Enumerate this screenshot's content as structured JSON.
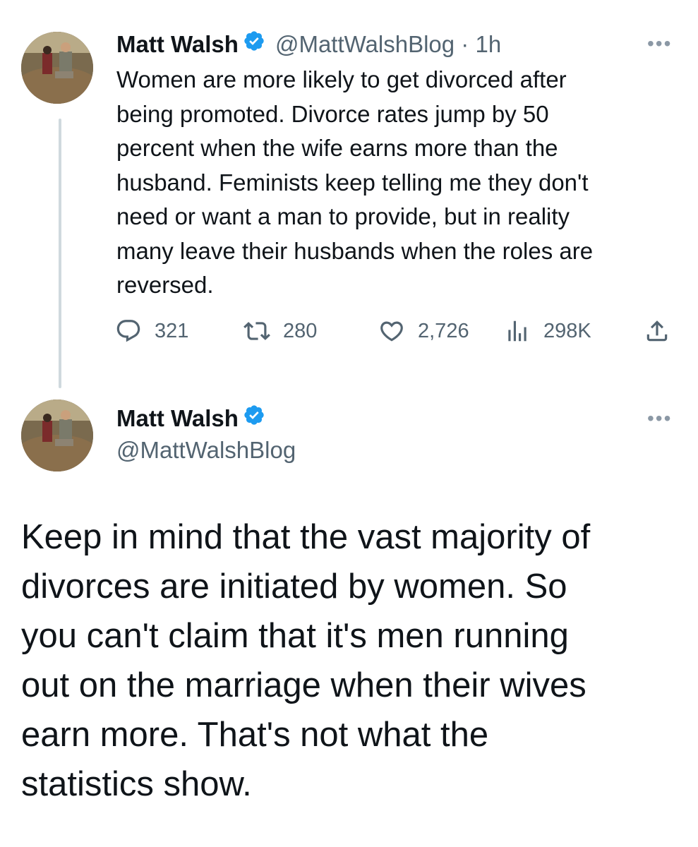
{
  "tweet1": {
    "author_name": "Matt Walsh",
    "handle_time": "@MattWalshBlog · 1h",
    "text": "Women are more likely to get divorced after\nbeing promoted. Divorce rates jump by 50\npercent when the wife earns more than the\nhusband. Feminists keep telling me they don't\nneed or want a man to provide, but in reality\nmany leave their husbands when the roles are\nreversed.",
    "more_label": "•••",
    "replies": "321",
    "retweets": "280",
    "likes": "2,726",
    "views": "298K"
  },
  "tweet2": {
    "author_name": "Matt Walsh",
    "handle": "@MattWalshBlog",
    "more_label": "•••",
    "text": "Keep in mind that the vast majority of\ndivorces are initiated by women. So\nyou can't claim that it's men running\nout on the marriage when their wives\nearn more. That's not what the\nstatistics show."
  },
  "icons": {
    "reply": "reply-icon",
    "retweet": "retweet-icon",
    "like": "heart-icon",
    "views": "views-icon",
    "share": "share-icon",
    "verified": "verified-badge-icon"
  },
  "colors": {
    "verified": "#1d9bf0",
    "muted": "#536471",
    "text": "#0f1419"
  }
}
